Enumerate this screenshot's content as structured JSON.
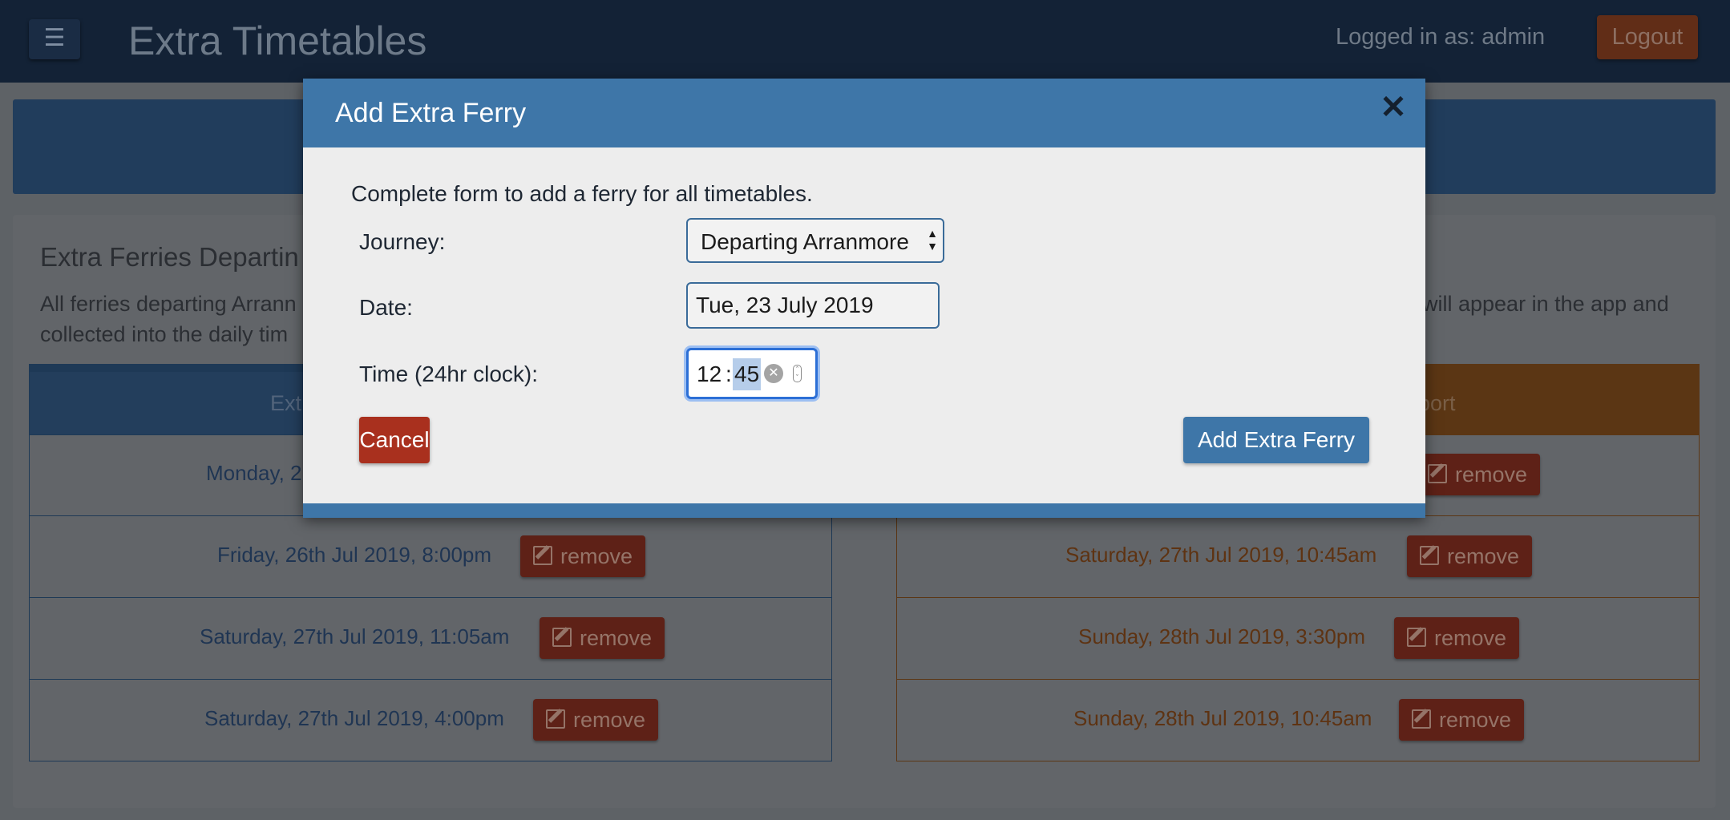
{
  "app": {
    "title": "Extra Timetables",
    "menu_icon": "hamburger-icon",
    "logged_in_text": "Logged in as: admin",
    "logout_label": "Logout"
  },
  "section": {
    "title": "Extra Ferries Departin",
    "description_left": "All ferries departing Arrann",
    "description_right": "will appear in the app and",
    "description_line2": "collected into the daily tim"
  },
  "left_column": {
    "header": "Ext",
    "rows": [
      {
        "text": "Monday, 2",
        "button": "remove"
      },
      {
        "text": "Friday, 26th Jul 2019, 8:00pm",
        "button": "remove"
      },
      {
        "text": "Saturday, 27th Jul 2019, 11:05am",
        "button": "remove"
      },
      {
        "text": "Saturday, 27th Jul 2019, 4:00pm",
        "button": "remove"
      }
    ]
  },
  "right_column": {
    "header": "port",
    "rows": [
      {
        "text": "",
        "button": "remove"
      },
      {
        "text": "Saturday, 27th Jul 2019, 10:45am",
        "button": "remove"
      },
      {
        "text": "Sunday, 28th Jul 2019, 3:30pm",
        "button": "remove"
      },
      {
        "text": "Sunday, 28th Jul 2019, 10:45am",
        "button": "remove"
      }
    ]
  },
  "modal": {
    "title": "Add Extra Ferry",
    "close_icon": "close-icon",
    "intro": "Complete form to add a ferry for all timetables.",
    "journey_label": "Journey:",
    "journey_value": "Departing Arranmore",
    "date_label": "Date:",
    "date_value": "Tue, 23 July 2019",
    "time_label": "Time (24hr clock):",
    "time_hours": "12",
    "time_minutes": "45",
    "cancel_label": "Cancel",
    "submit_label": "Add Extra Ferry"
  },
  "colors": {
    "modal_accent": "#3e76a8",
    "danger": "#a9301e",
    "topbar": "#132236"
  }
}
